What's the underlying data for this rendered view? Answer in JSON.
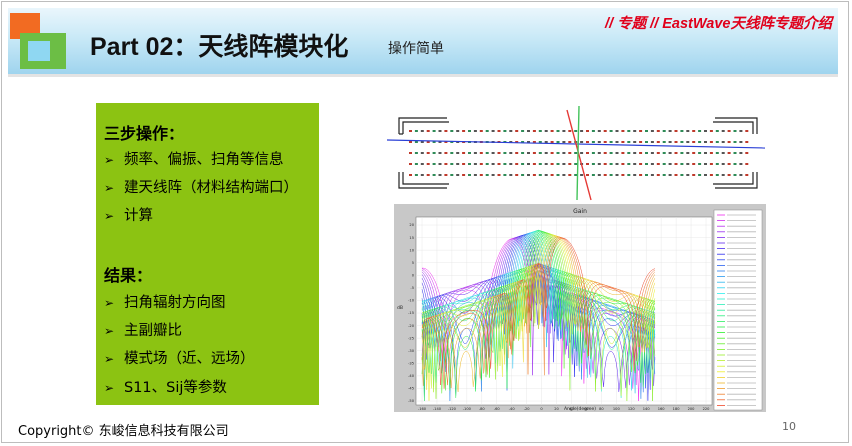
{
  "header": {
    "title": "Part 02：天线阵模块化",
    "subtitle": "操作简单",
    "tagline": "// 专题 // EastWave天线阵专题介绍"
  },
  "steps": {
    "heading": "三步操作：",
    "items": [
      "频率、偏振、扫角等信息",
      "建天线阵（材料结构端口）",
      "计算"
    ]
  },
  "results": {
    "heading": "结果：",
    "items": [
      "扫角辐射方向图",
      "主副瓣比",
      "模式场（近、远场）",
      "S11、Sij等参数"
    ]
  },
  "footer": {
    "copyright": "Copyright© 东峻信息科技有限公司",
    "page_number": "10"
  },
  "plot": {
    "title": "Gain",
    "xlabel": "Angle(degree)",
    "ylabel": "dB",
    "x_ticks": [
      "-160",
      "-140",
      "-120",
      "-100",
      "-80",
      "-60",
      "-40",
      "-20",
      "0",
      "20",
      "40",
      "60",
      "80",
      "100",
      "120",
      "140",
      "160",
      "180",
      "200",
      "220"
    ],
    "y_ticks": [
      "20",
      "15",
      "10",
      "5",
      "0",
      "-5",
      "-10",
      "-15",
      "-20",
      "-25",
      "-30",
      "-35",
      "-40",
      "-45",
      "-50"
    ],
    "legend_entries": 35
  },
  "colors": {
    "accent_red": "#e0001b",
    "green_panel": "#8cc312",
    "header_blue": "#9fd4ee"
  }
}
